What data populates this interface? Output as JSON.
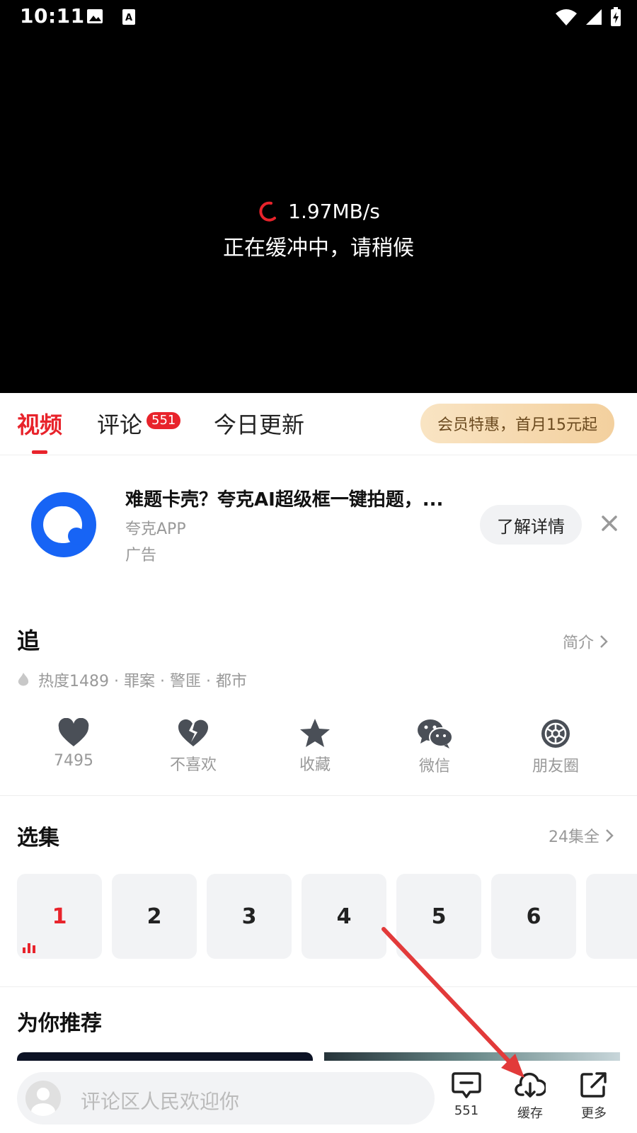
{
  "status_bar": {
    "time": "10:11"
  },
  "player": {
    "speed": "1.97MB/s",
    "buffering_text": "正在缓冲中，请稍候"
  },
  "tabs": {
    "video": "视频",
    "comment": "评论",
    "comment_count": "551",
    "today": "今日更新",
    "vip_promo": "会员特惠，首月15元起"
  },
  "ad": {
    "title": "难题卡壳？夸克AI超级框一键拍题，...",
    "source": "夸克APP",
    "tag": "广告",
    "button": "了解详情"
  },
  "show": {
    "title": "追",
    "intro_link": "简介",
    "meta": "热度1489 · 罪案 · 警匪 · 都市"
  },
  "actions": [
    {
      "label": "7495",
      "icon": "heart-icon"
    },
    {
      "label": "不喜欢",
      "icon": "broken-heart-icon"
    },
    {
      "label": "收藏",
      "icon": "star-icon"
    },
    {
      "label": "微信",
      "icon": "wechat-icon"
    },
    {
      "label": "朋友圈",
      "icon": "moments-icon"
    }
  ],
  "episodes": {
    "title": "选集",
    "all_link": "24集全",
    "items": [
      "1",
      "2",
      "3",
      "4",
      "5",
      "6"
    ],
    "active": "1"
  },
  "recommend": {
    "title": "为你推荐"
  },
  "bottom_bar": {
    "comment_placeholder": "评论区人民欢迎你",
    "comment_count": "551",
    "download_label": "缓存",
    "more_label": "更多"
  },
  "colors": {
    "accent": "#e8232b",
    "ad_logo": "#1764f5",
    "annotation_arrow": "#e23a3a"
  }
}
